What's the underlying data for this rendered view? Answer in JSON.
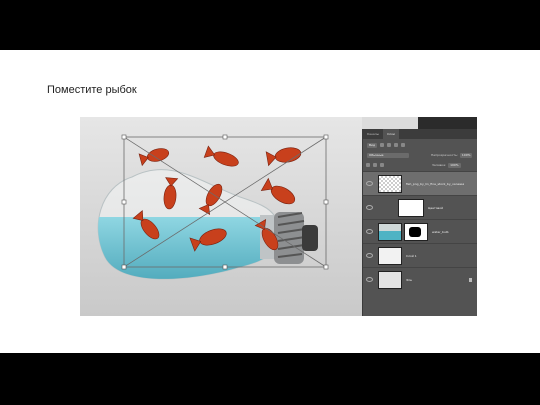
{
  "slide": {
    "title": "Поместите рыбок"
  },
  "layers_panel": {
    "tabs": [
      "Каналы",
      "Слои"
    ],
    "kind_filter": "Вид",
    "blend_mode": "Обычные",
    "opacity_label": "Непрозрачность:",
    "opacity_value": "100%",
    "fill_label": "Заливка:",
    "fill_value": "100%",
    "layers": [
      {
        "name": "fish_png_by_lin_fine_stock_by_vanessa",
        "thumb": "checker"
      },
      {
        "name": "Цветовой",
        "thumb": "mask"
      },
      {
        "name": "water_bulb",
        "thumb": "photo"
      },
      {
        "name": "Слой 1",
        "thumb": "plain"
      },
      {
        "name": "Фон",
        "thumb": "plain"
      }
    ]
  },
  "colors": {
    "background": "#000000",
    "slide": "#ffffff",
    "panel": "#535353",
    "water": "#4fb3c4",
    "fish": "#c8401c"
  }
}
